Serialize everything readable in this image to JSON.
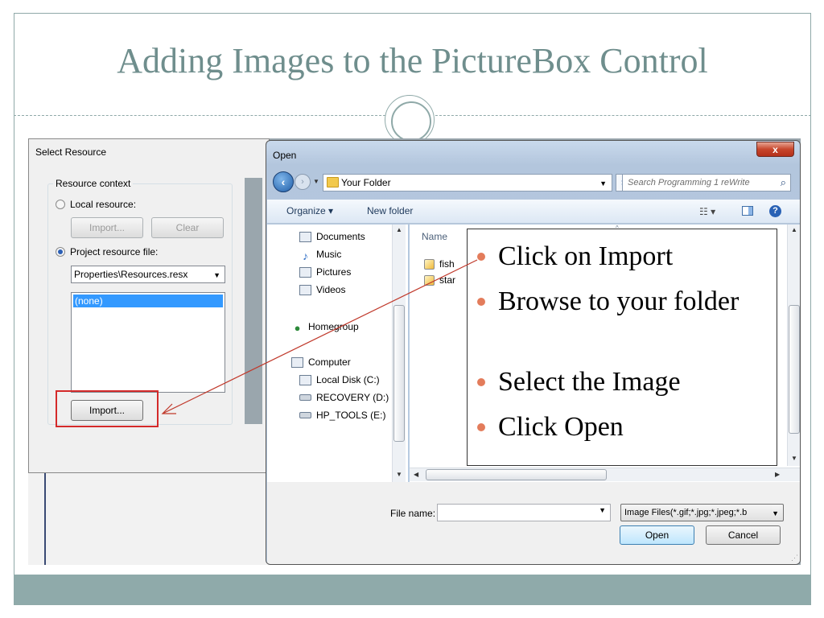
{
  "slide": {
    "title": "Adding Images to the PictureBox Control"
  },
  "select_resource": {
    "title": "Select Resource",
    "group_label": "Resource context",
    "local_resource_label": "Local resource:",
    "import_label": "Import...",
    "clear_label": "Clear",
    "project_resource_label": "Project resource file:",
    "resource_file_value": "Properties\\Resources.resx",
    "resource_items": [
      "(none)"
    ],
    "import_button_label": "Import..."
  },
  "open_dialog": {
    "title": "Open",
    "close_glyph": "x",
    "address_value": "Your Folder",
    "search_placeholder": "Search Programming 1 reWrite",
    "toolbar": {
      "organize_label": "Organize ▾",
      "new_folder_label": "New folder"
    },
    "nav_items": {
      "documents": "Documents",
      "music": "Music",
      "pictures": "Pictures",
      "videos": "Videos",
      "homegroup": "Homegroup",
      "computer": "Computer",
      "local_disk": "Local Disk (C:)",
      "recovery": "RECOVERY (D:)",
      "hp_tools": "HP_TOOLS (E:)"
    },
    "column_header": "Name",
    "files": [
      "fish",
      "star"
    ],
    "file_name_label": "File name:",
    "file_name_value": "",
    "filter_value": "Image Files(*.gif;*.jpg;*.jpeg;*.b",
    "open_label": "Open",
    "cancel_label": "Cancel"
  },
  "callout": {
    "bullets": [
      "Click on Import",
      "Browse to your folder",
      "Select the Image",
      "Click Open"
    ]
  },
  "colors": {
    "title": "#6f8e8d",
    "accent": "#8faaaa",
    "bullet": "#e37c5b",
    "highlight": "#d42a2a"
  }
}
